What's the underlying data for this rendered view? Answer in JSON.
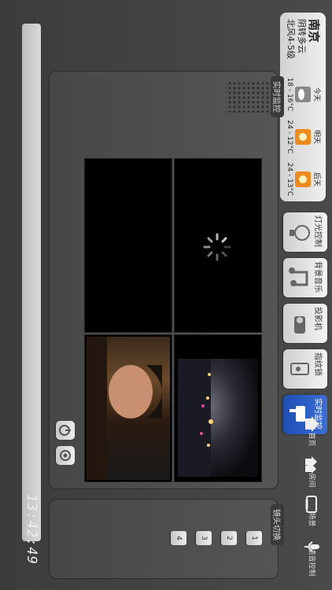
{
  "weather": {
    "city": "南京",
    "condition": "阴转多云",
    "wind": "北风4-5级",
    "days": [
      {
        "name": "今天",
        "temp": "18 - 16°C",
        "icon": "cloud-icon"
      },
      {
        "name": "明天",
        "temp": "24 - 12°C",
        "icon": "sun-icon"
      },
      {
        "name": "后天",
        "temp": "24 - 13°C",
        "icon": "sun-icon"
      }
    ]
  },
  "nav": {
    "items": [
      {
        "label": "灯光控制",
        "icon": "lamp-icon"
      },
      {
        "label": "背景音乐",
        "icon": "music-note-icon"
      },
      {
        "label": "投影机",
        "icon": "projector-icon"
      },
      {
        "label": "指纹锁",
        "icon": "fingerprint-lock-icon"
      },
      {
        "label": "实时监控",
        "icon": "camera-icon",
        "active": true
      }
    ]
  },
  "monitor": {
    "tab_label": "实时监控",
    "status": "loading"
  },
  "camera_switch": {
    "tab_label": "镜头切换",
    "buttons": [
      "1",
      "2",
      "3",
      "4"
    ]
  },
  "clock": "13:42:49",
  "bottom_nav": [
    {
      "label": "首页",
      "icon": "home-icon"
    },
    {
      "label": "房间",
      "icon": "rooms-icon"
    },
    {
      "label": "场景",
      "icon": "scene-icon"
    },
    {
      "label": "语音控制",
      "icon": "microphone-icon"
    }
  ],
  "accent_color": "#2a5fc7"
}
